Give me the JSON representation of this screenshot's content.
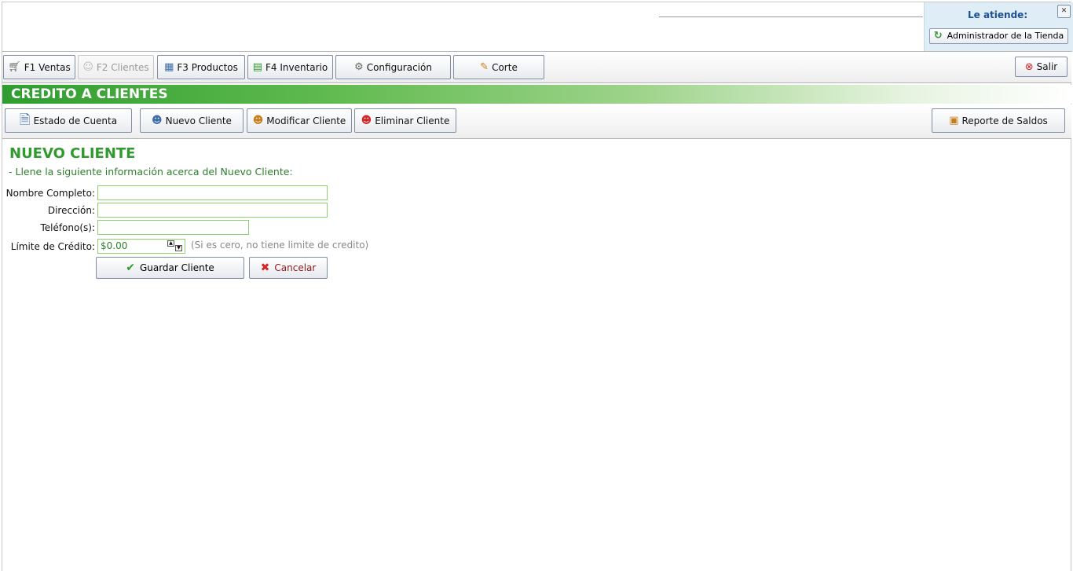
{
  "header": {
    "attended_label": "Le atiende:",
    "user_button": "Administrador de la Tienda"
  },
  "menu": {
    "items": [
      {
        "label": "F1 Ventas",
        "icon": "cart-icon",
        "disabled": false
      },
      {
        "label": "F2 Clientes",
        "icon": "clients-icon",
        "disabled": true
      },
      {
        "label": "F3 Productos",
        "icon": "products-icon",
        "disabled": false
      },
      {
        "label": "F4 Inventario",
        "icon": "inventory-icon",
        "disabled": false
      },
      {
        "label": "Configuración",
        "icon": "gear-icon",
        "disabled": false
      },
      {
        "label": "Corte",
        "icon": "cut-icon",
        "disabled": false
      }
    ],
    "exit_label": "Salir"
  },
  "section": {
    "title": "CREDITO A CLIENTES"
  },
  "actions": {
    "account_statement": "Estado de Cuenta",
    "new_client": "Nuevo Cliente",
    "edit_client": "Modificar Cliente",
    "delete_client": "Eliminar Cliente",
    "balance_report": "Reporte de Saldos"
  },
  "form": {
    "title": "NUEVO CLIENTE",
    "subtitle": "- Llene la siguiente información acerca del Nuevo Cliente:",
    "fields": {
      "name_label": "Nombre Completo:",
      "name_value": "",
      "address_label": "Dirección:",
      "address_value": "",
      "phone_label": "Teléfono(s):",
      "phone_value": "",
      "credit_label": "Límite de Crédito:",
      "credit_value": "$0.00",
      "credit_hint": "(Si es cero, no tiene limite de credito)"
    },
    "save_label": "Guardar Cliente",
    "cancel_label": "Cancelar"
  },
  "colors": {
    "accent_green": "#2f9b2f",
    "input_border": "#8fd06e",
    "user_panel_bg": "#dfeef6",
    "user_label": "#1d4f91"
  }
}
